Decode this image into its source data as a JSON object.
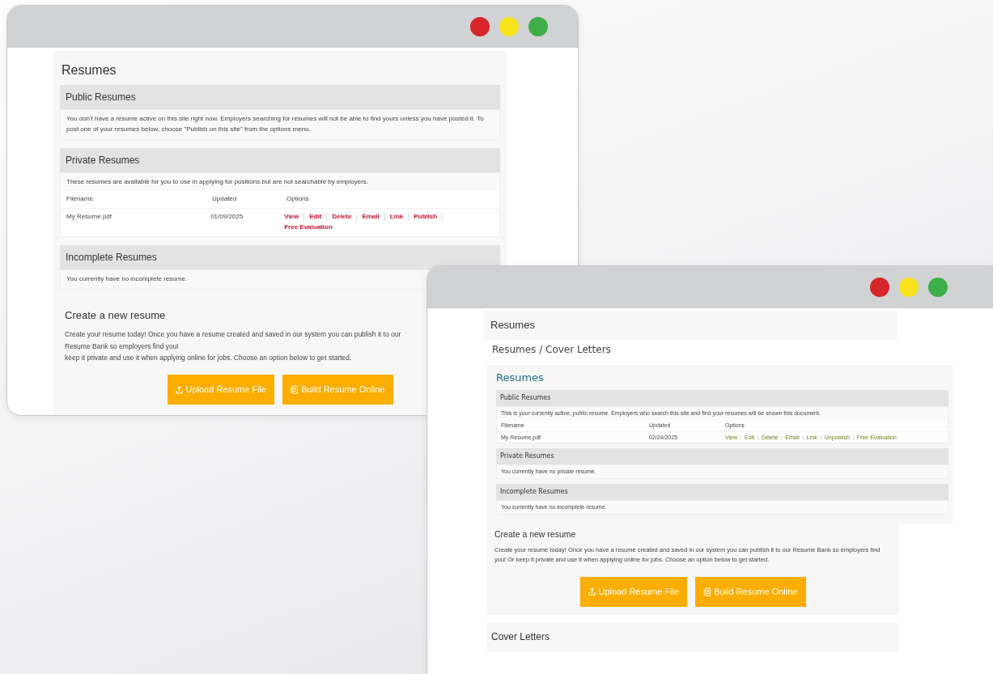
{
  "windows": [
    {
      "kind": "back",
      "page_title": "Resumes",
      "sections": [
        {
          "heading": "Public Resumes",
          "text": "You don't have a resume active on this site right now. Employers searching for resumes will not be able to find yours unless you have posted it. To post one of your resumes below, choose \"Publish on this site\" from the options menu."
        },
        {
          "heading": "Private Resumes",
          "text": "These resumes are available for you to use in applying for positions but are not searchable by employers.",
          "table": {
            "columns": [
              "Filename",
              "Updated",
              "Options"
            ],
            "rows": [
              {
                "filename": "My Resume.pdf",
                "updated": "01/09/2025",
                "options": [
                  "View",
                  "Edit",
                  "Delete",
                  "Email",
                  "Link",
                  "Publish",
                  "Free Evaluation"
                ]
              }
            ]
          }
        },
        {
          "heading": "Incomplete Resumes",
          "text": "You currently have no incomplete resume."
        }
      ],
      "create": {
        "heading": "Create a new resume",
        "lines": [
          "Create your resume today! Once you have a resume created and saved in our system you can publish it to our Resume Bank so employers find you!",
          "keep it private and use it when applying online for jobs. Choose an option below to get started."
        ],
        "buttons": [
          {
            "label": "Upload Resume File"
          },
          {
            "label": "Build Resume Online"
          }
        ]
      }
    },
    {
      "kind": "front",
      "page_title": "Resumes",
      "breadcrumb": "Resumes / Cover Letters",
      "section_title": "Resumes",
      "sections": [
        {
          "heading": "Public Resumes",
          "text": "This is your currently active, public resume. Employers who search this site and find your resumes will be shown this document.",
          "table": {
            "columns": [
              "Filename",
              "Updated",
              "Options"
            ],
            "rows": [
              {
                "filename": "My Resume.pdf",
                "updated": "02/24/2025",
                "options": [
                  "View",
                  "Edit",
                  "Delete",
                  "Email",
                  "Link",
                  "Unpublish",
                  "Free Evaluation"
                ]
              }
            ]
          }
        },
        {
          "heading": "Private Resumes",
          "text": "You currently have no private resume."
        },
        {
          "heading": "Incomplete Resumes",
          "text": "You currently have no incomplete resume."
        }
      ],
      "create": {
        "heading": "Create a new resume",
        "lines": [
          "Create your resume today! Once you have a resume created and saved in our system you can publish it to our Resume Bank so employers find you! Or keep it private and use it when applying online for jobs. Choose an option below to get started."
        ],
        "buttons": [
          {
            "label": "Upload Resume File"
          },
          {
            "label": "Build Resume Online"
          }
        ]
      },
      "cover_letters": "Cover Letters"
    }
  ]
}
